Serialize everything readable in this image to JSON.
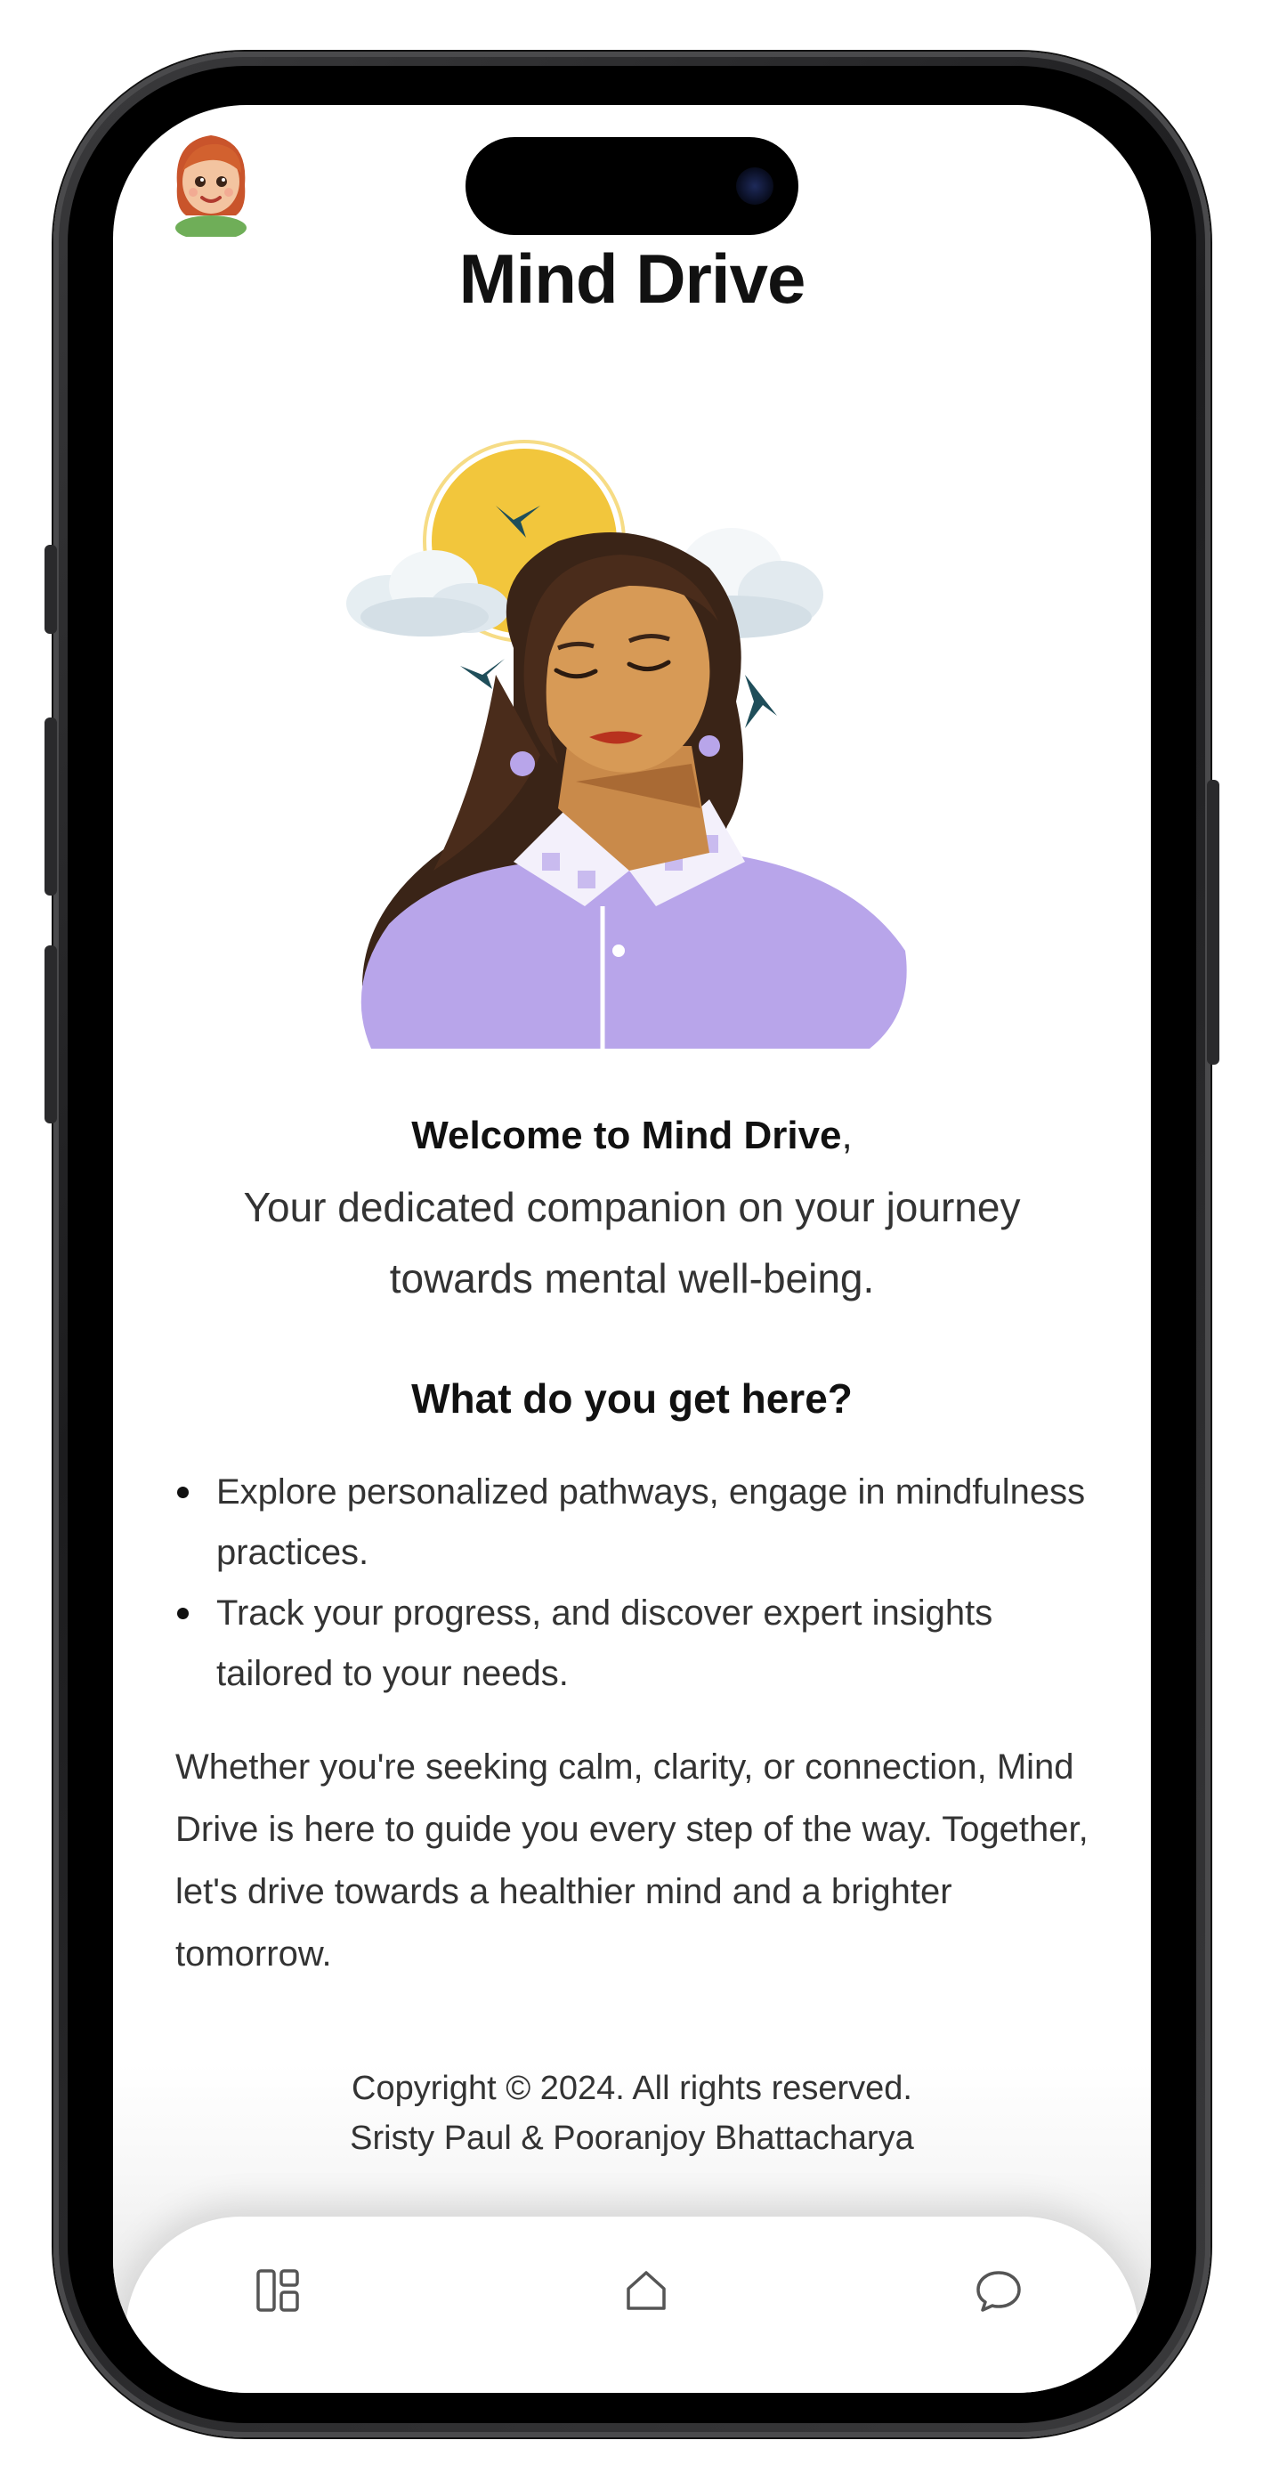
{
  "app": {
    "title": "Mind Drive"
  },
  "welcome": {
    "heading": "Welcome to Mind Drive",
    "heading_suffix": ",",
    "tagline": "Your dedicated companion on your journey towards mental well-being."
  },
  "features": {
    "heading": "What do you get here?",
    "items": [
      "Explore personalized pathways, engage in mindfulness practices.",
      "Track your progress, and discover expert insights tailored to your needs."
    ]
  },
  "closing": "Whether you're seeking calm, clarity, or connection, Mind Drive is here to guide you every step of the way. Together, let's drive towards a healthier mind and a brighter tomorrow.",
  "footer": {
    "copyright": "Copyright © 2024. All rights reserved.",
    "authors": "Sristy Paul & Pooranjoy Bhattacharya"
  },
  "nav": {
    "items": [
      {
        "icon": "dashboard-icon"
      },
      {
        "icon": "home-icon"
      },
      {
        "icon": "chat-icon"
      }
    ]
  },
  "colors": {
    "accent_lavender": "#b8a5ea",
    "sun_yellow": "#f2c63c",
    "text_dark": "#111111",
    "text_body": "#333333"
  }
}
